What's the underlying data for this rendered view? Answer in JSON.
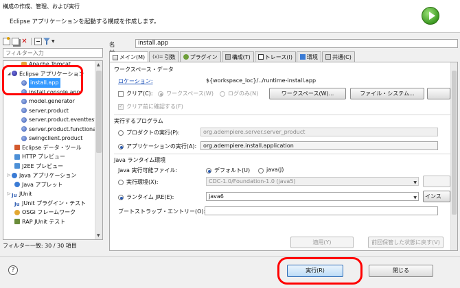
{
  "dialog": {
    "title": "構成の作成、管理、および実行",
    "description": "Eclipse アプリケーションを起動する構成を作成します。"
  },
  "left": {
    "filter_placeholder": "フィルター入力",
    "tree": [
      {
        "label": "Apache Tomcat",
        "level": 1,
        "icon": "tomcat-icon"
      },
      {
        "label": "Eclipse アプリケーション",
        "level": 0,
        "icon": "eclipse-icon",
        "expanded": true
      },
      {
        "label": "install.app",
        "level": 1,
        "icon": "config-icon",
        "selected": true
      },
      {
        "label": "install.console.app",
        "level": 1,
        "icon": "config-icon"
      },
      {
        "label": "model.generator",
        "level": 1,
        "icon": "config-icon"
      },
      {
        "label": "server.product",
        "level": 1,
        "icon": "config-icon"
      },
      {
        "label": "server.product.eventtest",
        "level": 1,
        "icon": "config-icon"
      },
      {
        "label": "server.product.functional",
        "level": 1,
        "icon": "config-icon"
      },
      {
        "label": "swingclient.product",
        "level": 1,
        "icon": "config-icon"
      },
      {
        "label": "Eclipse データ・ツール",
        "level": 0,
        "icon": "data-tool-icon"
      },
      {
        "label": "HTTP プレビュー",
        "level": 0,
        "icon": "http-icon"
      },
      {
        "label": "J2EE プレビュー",
        "level": 0,
        "icon": "http-icon"
      },
      {
        "label": "Java アプリケーション",
        "level": 0,
        "icon": "java-icon",
        "collapsed": true
      },
      {
        "label": "Java アプレット",
        "level": 0,
        "icon": "java-icon"
      },
      {
        "label": "JUnit",
        "level": 0,
        "icon": "junit-icon",
        "collapsed": true
      },
      {
        "label": "JUnit プラグイン・テスト",
        "level": 0,
        "icon": "junit-icon"
      },
      {
        "label": "OSGi フレームワーク",
        "level": 0,
        "icon": "osgi-icon"
      },
      {
        "label": "RAP JUnit テスト",
        "level": 0,
        "icon": "rap-icon"
      }
    ],
    "status": "フィルター一致: 30 / 30 項目"
  },
  "right": {
    "name_label": "名前(N):",
    "name_value": "install.app",
    "tabs": [
      {
        "label": "メイン(M)",
        "icon": "main-tab-icon",
        "active": true
      },
      {
        "label": "引数",
        "icon": "args-tab-icon"
      },
      {
        "label": "プラグイン",
        "icon": "plugin-tab-icon"
      },
      {
        "label": "構成(T)",
        "icon": "config-tab-icon"
      },
      {
        "label": "トレース(I)",
        "icon": "trace-tab-icon"
      },
      {
        "label": "環境",
        "icon": "env-tab-icon"
      },
      {
        "label": "共通(C)",
        "icon": "common-tab-icon"
      }
    ],
    "workspace": {
      "title": "ワークスペース・データ",
      "location_label": "ロケーション:",
      "location_value": "${workspace_loc}/../runtime-install.app",
      "clear_label": "クリア(C):",
      "radio_workspace": "ワークスペース(W)",
      "radio_log": "ログのみ(N)",
      "btn_workspace": "ワークスペース(W)...",
      "btn_filesystem": "ファイル・システム...",
      "confirm_clear": "クリア前に確認する(F)"
    },
    "program": {
      "title": "実行するプログラム",
      "product_label": "プロダクトの実行(P):",
      "product_value": "org.adempiere.server.server_product",
      "app_label": "アプリケーションの実行(A):",
      "app_value": "org.adempiere.install.application"
    },
    "jre": {
      "title": "Java ランタイム環境",
      "exec_label": "Java 実行可能ファイル:",
      "radio_default": "デフォルト(U)",
      "radio_java": "java(J)",
      "env_label": "実行環境(X):",
      "env_value": "CDC-1.0/Foundation-1.0 (java5)",
      "runtime_label": "ランタイム JRE(E):",
      "runtime_value": "java6",
      "install_btn": "インス",
      "bootstrap_label": "ブートストラップ・エントリー(O):"
    },
    "apply_btn": "適用(Y)",
    "revert_btn": "前回保管した状態に戻す(V)"
  },
  "footer": {
    "help": "?",
    "run_btn": "実行(R)",
    "close_btn": "閉じる"
  },
  "colors": {
    "selection": "#3399ff",
    "annotation_red": "#ff0000",
    "link": "#1a4fb8"
  }
}
